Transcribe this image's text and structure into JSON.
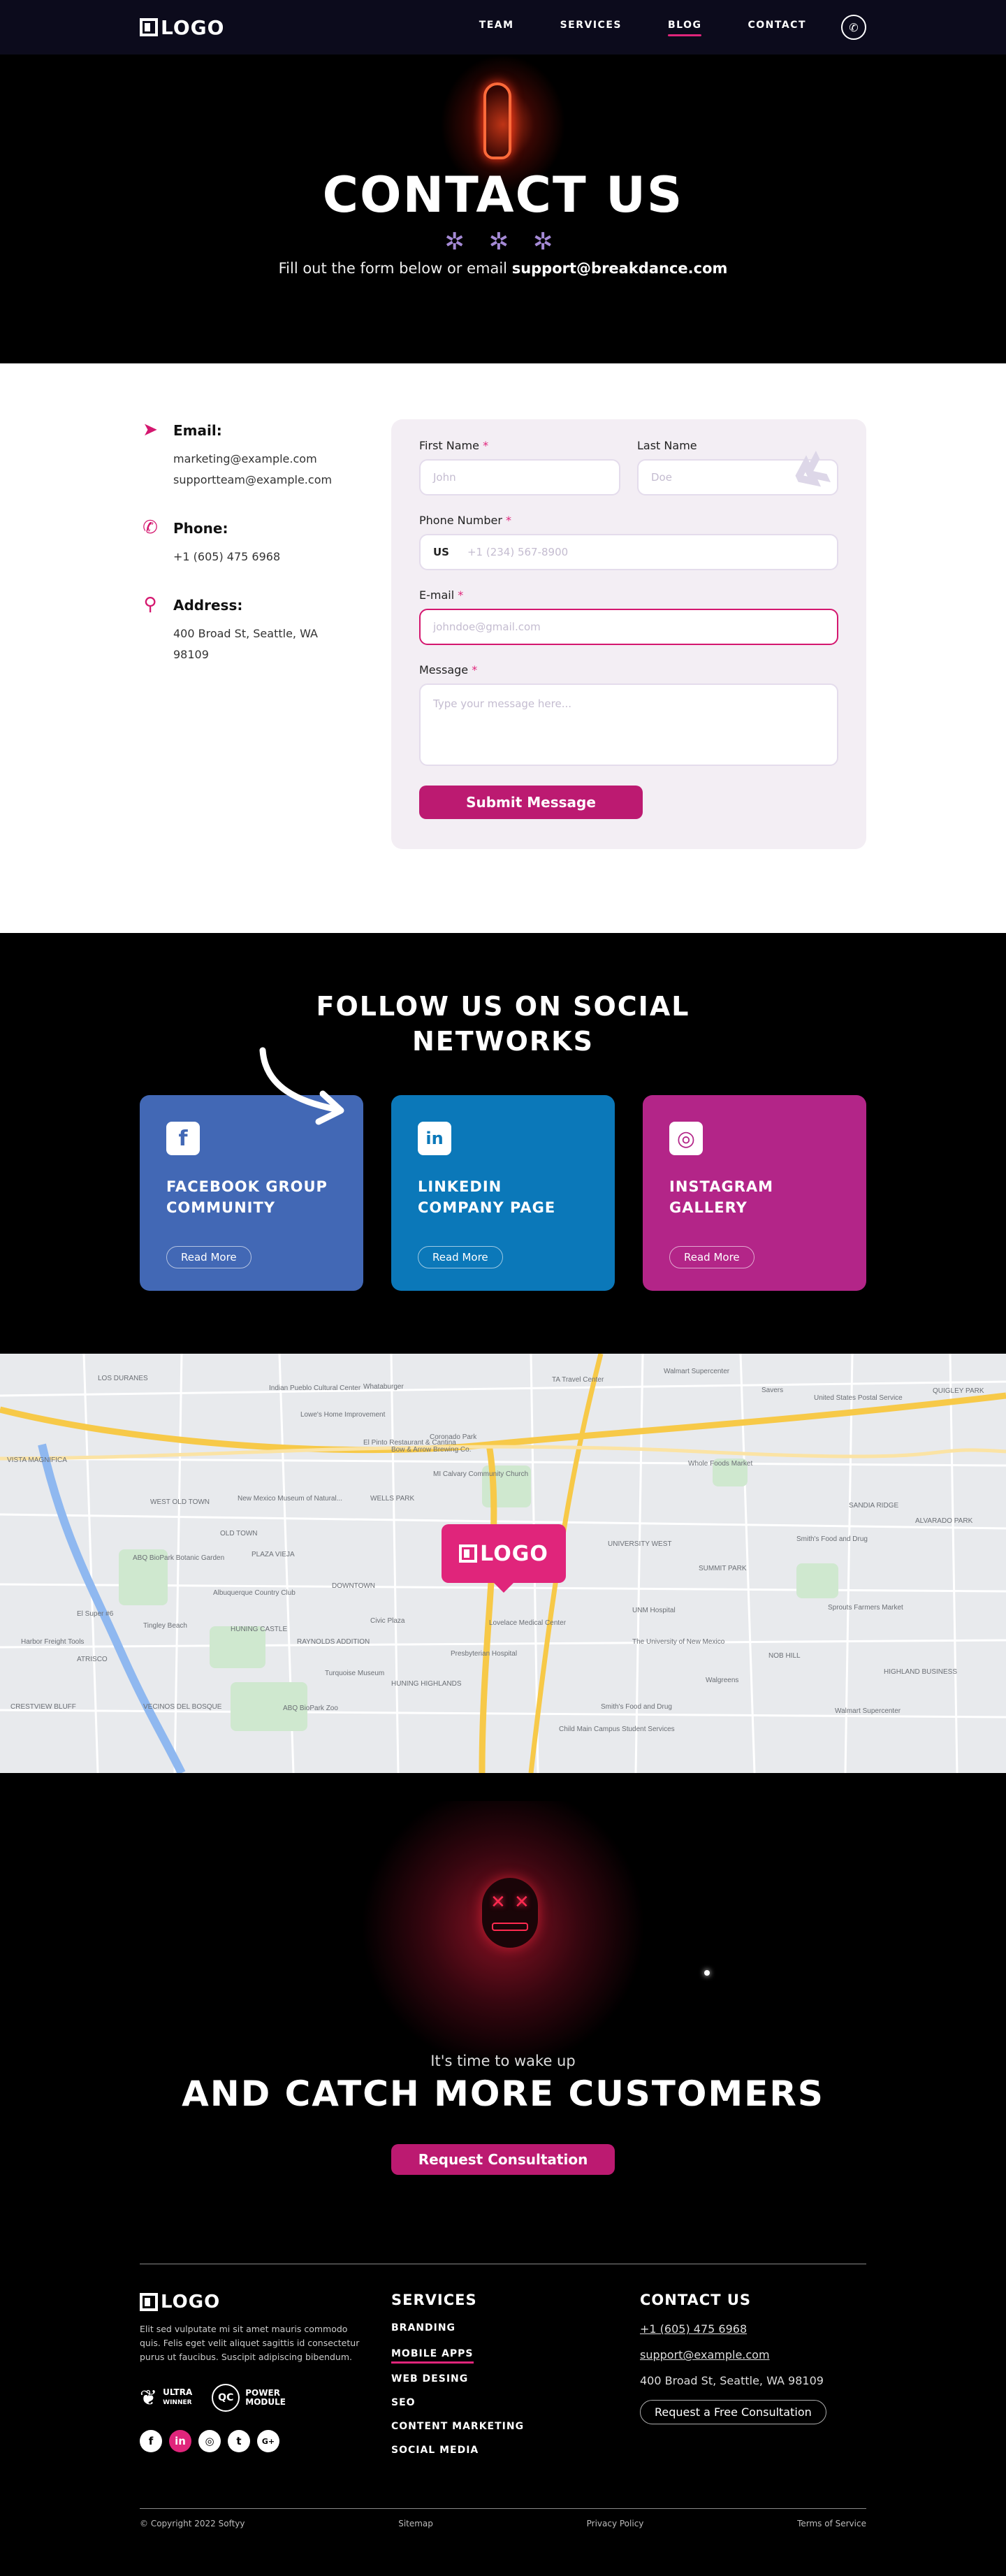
{
  "nav": {
    "logo": "LOGO",
    "items": [
      {
        "label": "TEAM",
        "active": false
      },
      {
        "label": "SERVICES",
        "active": false
      },
      {
        "label": "BLOG",
        "active": true
      },
      {
        "label": "CONTACT",
        "active": false
      }
    ],
    "phone_icon": "phone-icon"
  },
  "hero": {
    "title": "CONTACT US",
    "stars": "✲ ✲ ✲",
    "subtitle_prefix": "Fill out the form below or email ",
    "subtitle_email": "support@breakdance.com"
  },
  "contact": {
    "email_title": "Email:",
    "email_1": "marketing@example.com",
    "email_2": "supportteam@example.com",
    "phone_title": "Phone:",
    "phone": "+1 (605) 475 6968",
    "address_title": "Address:",
    "address_line1": "400 Broad St, Seattle, WA",
    "address_line2": "98109"
  },
  "form": {
    "first_name_label": "First Name",
    "first_name_placeholder": "John",
    "last_name_label": "Last Name",
    "last_name_placeholder": "Doe",
    "phone_label": "Phone Number",
    "phone_country": "US",
    "phone_placeholder": "+1 (234) 567-8900",
    "email_label": "E-mail",
    "email_placeholder": "johndoe@gmail.com",
    "message_label": "Message",
    "message_placeholder": "Type your message here...",
    "required_mark": "*",
    "submit": "Submit Message"
  },
  "social": {
    "title_line1": "FOLLOW US ON SOCIAL",
    "title_line2": "NETWORKS",
    "cards": [
      {
        "icon": "f",
        "line1": "FACEBOOK GROUP",
        "line2": "COMMUNITY",
        "button": "Read More",
        "color": "#4268b5"
      },
      {
        "icon": "in",
        "line1": "LINKEDIN",
        "line2": "COMPANY PAGE",
        "button": "Read More",
        "color": "#0b78b9"
      },
      {
        "icon": "◎",
        "line1": "INSTAGRAM",
        "line2": "GALLERY",
        "button": "Read More",
        "color": "#b32588"
      }
    ]
  },
  "map": {
    "pin_logo": "LOGO",
    "labels": [
      "LOS DURANES",
      "Indian Pueblo Cultural Center",
      "Whataburger",
      "TA Travel Center",
      "Walmart Supercenter",
      "Savers",
      "United States Postal Service",
      "QUIGLEY PARK",
      "Lowe's Home Improvement",
      "El Pinto Restaurant & Cantina",
      "Bow & Arrow Brewing Co.",
      "Coronado Park",
      "VISTA MAGNIFICA",
      "WEST OLD TOWN",
      "New Mexico Museum of Natural...",
      "MI Calvary Community Church",
      "Whole Foods Market",
      "SANDIA RIDGE",
      "ALVARADO PARK",
      "WELLS PARK",
      "OLD TOWN",
      "UNIVERSITY WEST",
      "Smith's Food and Drug",
      "PLAZA VIEJA",
      "SUMMIT PARK",
      "ABQ BioPark Botanic Garden",
      "DOWNTOWN",
      "Albuquerque Country Club",
      "UNM Hospital",
      "Sprouts Farmers Market",
      "El Super #6",
      "Tingley Beach",
      "HUNING CASTLE",
      "Civic Plaza",
      "Lovelace Medical Center",
      "Harbor Freight Tools",
      "RAYNOLDS ADDITION",
      "Presbyterian Hospital",
      "The University of New Mexico",
      "NOB HILL",
      "HIGHLAND BUSINESS",
      "ATRISCO",
      "Turquoise Museum",
      "HUNING HIGHLANDS",
      "Walgreens",
      "CRESTVIEW BLUFF",
      "VECINOS DEL BOSQUE",
      "ABQ BioPark Zoo",
      "Smith's Food and Drug",
      "Walmart Supercenter",
      "Child Main Campus Student Services"
    ]
  },
  "cta": {
    "small": "It's time to wake up",
    "title": "AND CATCH MORE CUSTOMERS",
    "button": "Request Consultation"
  },
  "footer": {
    "logo": "LOGO",
    "desc": "Elit sed vulputate mi sit amet mauris commodo quis. Felis eget velit aliquet sagittis id consectetur purus ut faucibus. Suscipit adipiscing bibendum.",
    "badge1_line1": "ULTRA",
    "badge1_line2": "WINNER",
    "badge2_icon": "QC",
    "badge2_line1": "POWER",
    "badge2_line2": "MODULE",
    "socials": [
      "f",
      "in",
      "◎",
      "t",
      "G+"
    ],
    "services_title": "SERVICES",
    "services": [
      {
        "label": "BRANDING",
        "active": false
      },
      {
        "label": "MOBILE APPS",
        "active": true
      },
      {
        "label": "WEB DESING",
        "active": false
      },
      {
        "label": "SEO",
        "active": false
      },
      {
        "label": "CONTENT MARKETING",
        "active": false
      },
      {
        "label": "SOCIAL MEDIA",
        "active": false
      }
    ],
    "contact_title": "CONTACT US",
    "phone": "+1 (605) 475 6968",
    "email": "support@example.com",
    "address": "400 Broad St, Seattle, WA 98109",
    "request_button": "Request a Free Consultation",
    "copyright": "© Copyright 2022 Softyy",
    "sitemap": "Sitemap",
    "privacy": "Privacy Policy",
    "terms": "Terms of Service"
  }
}
